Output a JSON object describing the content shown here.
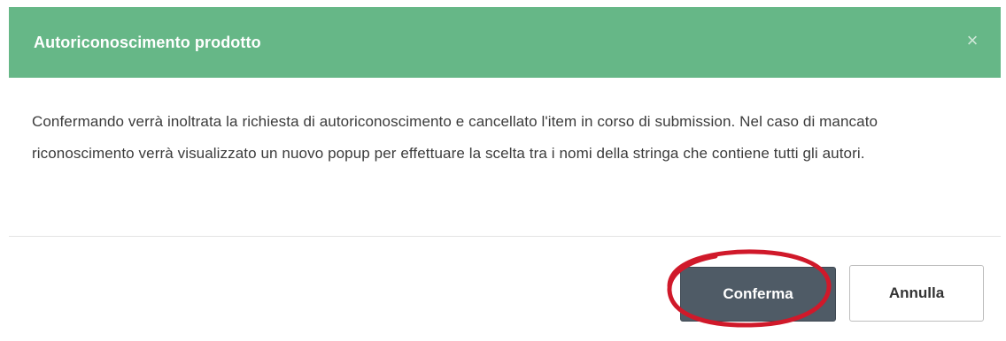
{
  "dialog": {
    "title": "Autoriconoscimento prodotto",
    "close_symbol": "×",
    "close_icon": "close-icon",
    "message": "Confermando verrà inoltrata la richiesta di autoriconoscimento e cancellato l'item in corso di submission. Nel caso di mancato riconoscimento verrà visualizzato un nuovo popup per effettuare la scelta tra i nomi della stringa che contiene tutti gli autori.",
    "confirm_label": "Conferma",
    "cancel_label": "Annulla"
  },
  "colors": {
    "header_bg": "#66b787",
    "confirm_bg": "#4f5b66",
    "highlight": "#d0192a"
  }
}
